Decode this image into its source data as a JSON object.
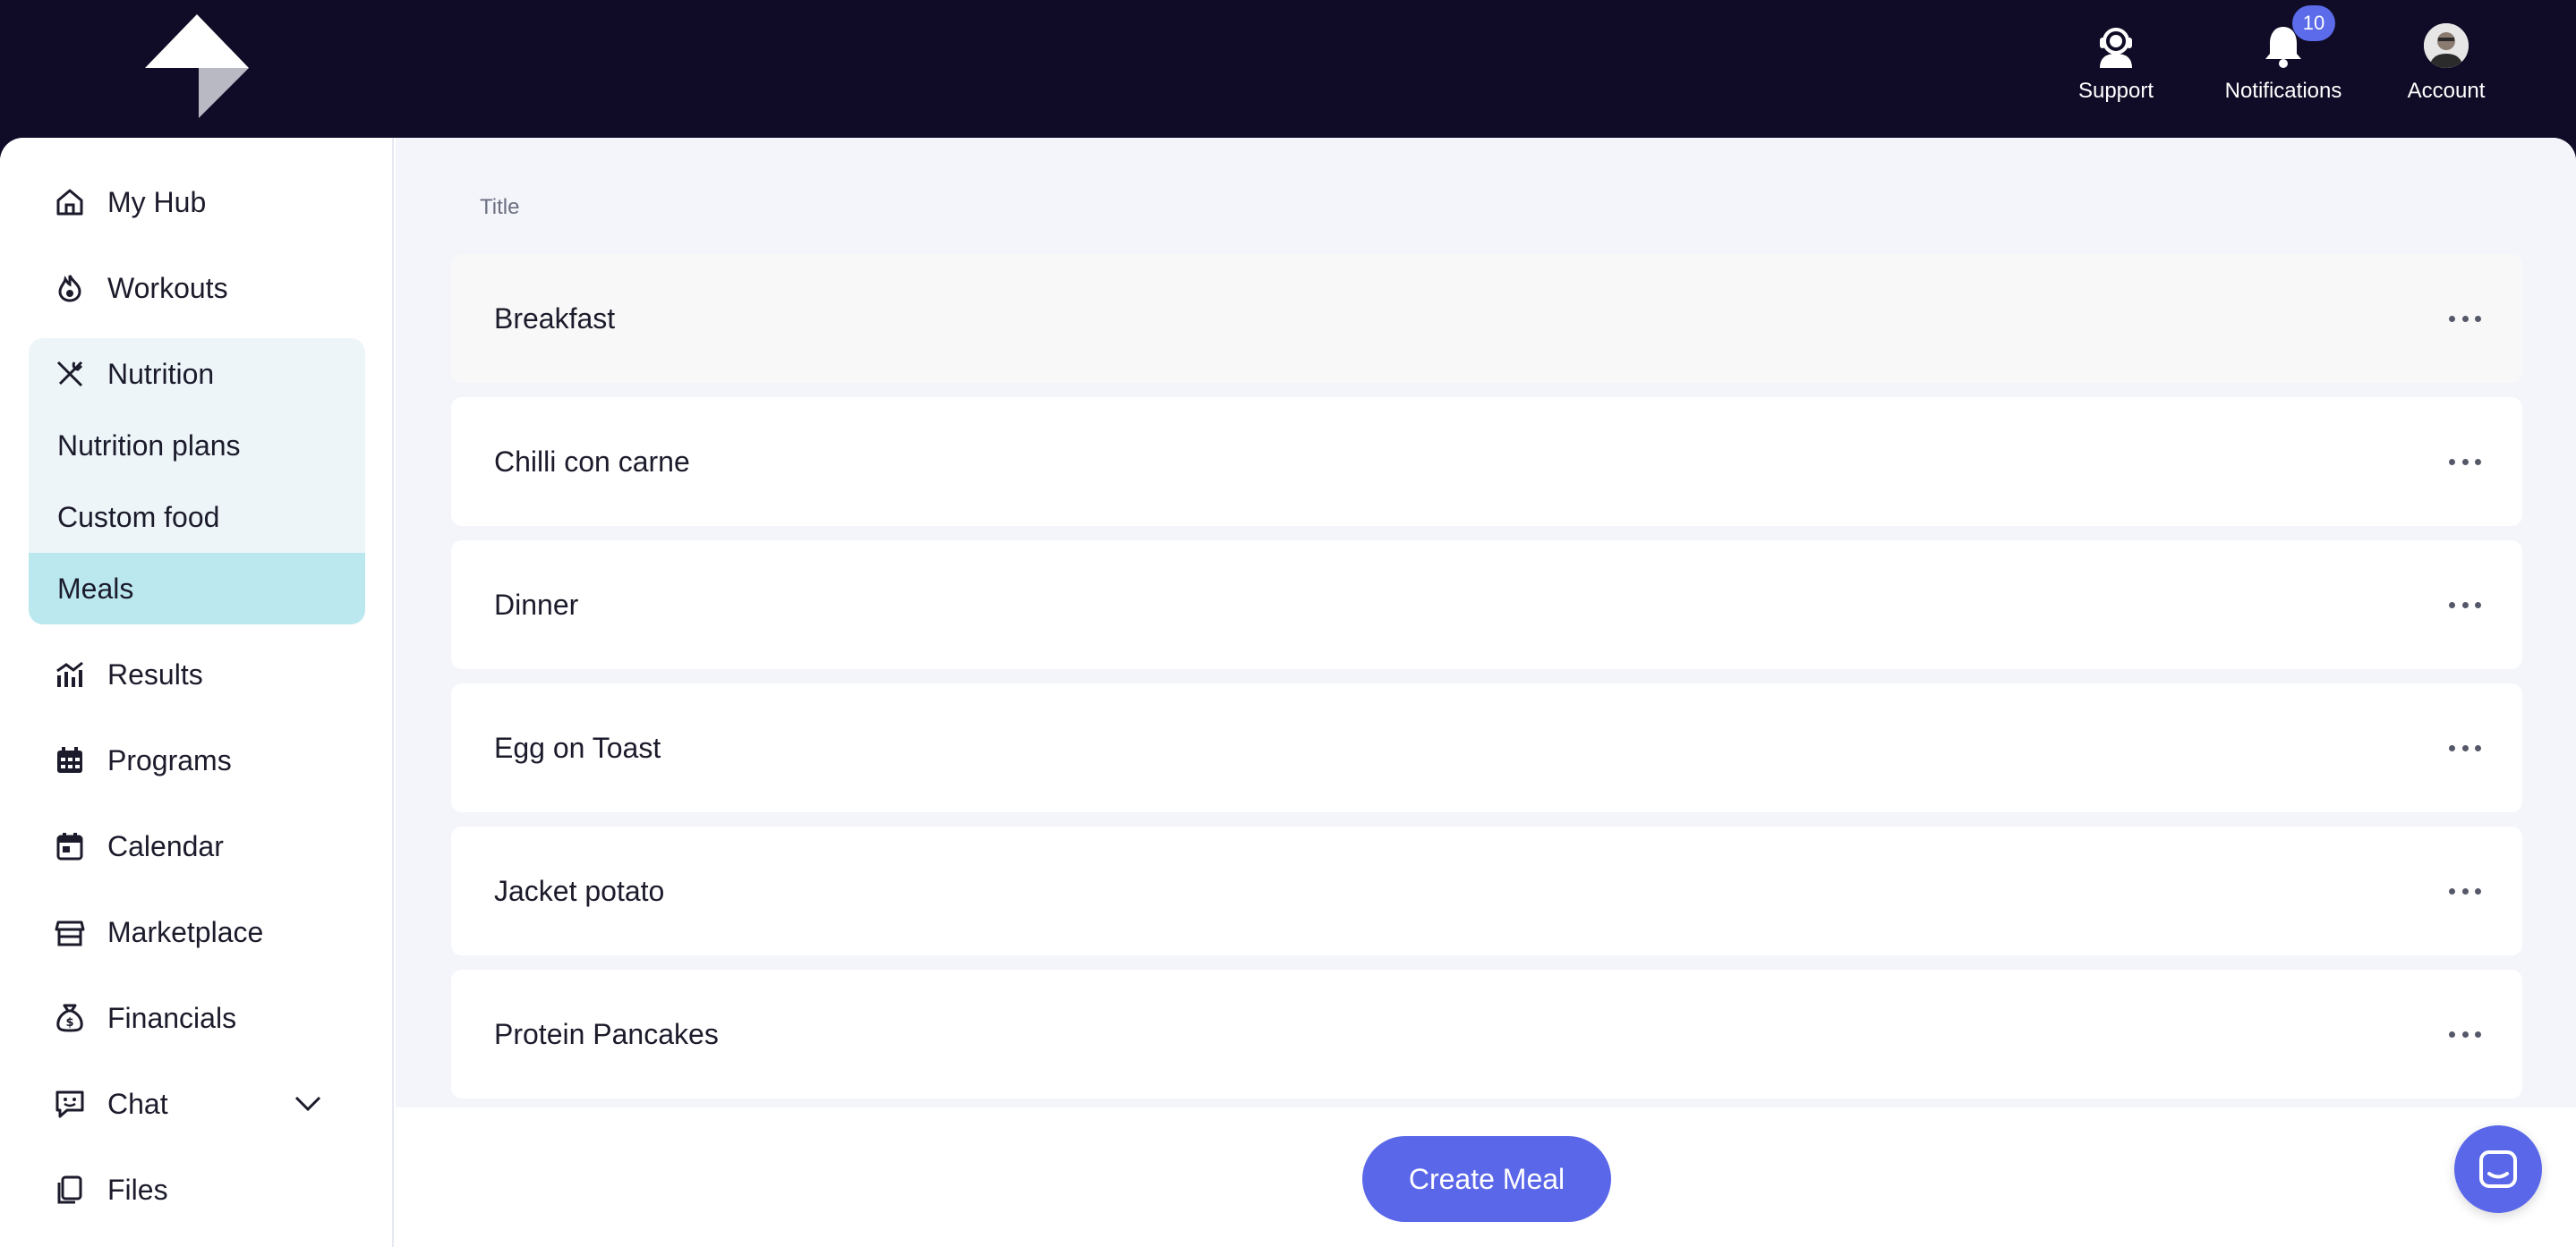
{
  "header": {
    "support_label": "Support",
    "notifications_label": "Notifications",
    "notifications_count": "10",
    "account_label": "Account"
  },
  "sidebar": {
    "items": [
      {
        "label": "My Hub",
        "icon": "home-icon"
      },
      {
        "label": "Workouts",
        "icon": "flame-icon"
      },
      {
        "label": "Nutrition",
        "icon": "utensils-icon"
      },
      {
        "label": "Results",
        "icon": "chart-icon"
      },
      {
        "label": "Programs",
        "icon": "calendar-grid-icon"
      },
      {
        "label": "Calendar",
        "icon": "calendar-icon"
      },
      {
        "label": "Marketplace",
        "icon": "store-icon"
      },
      {
        "label": "Financials",
        "icon": "money-bag-icon"
      },
      {
        "label": "Chat",
        "icon": "chat-icon"
      },
      {
        "label": "Files",
        "icon": "files-icon"
      }
    ],
    "nutrition_sub": [
      "Nutrition plans",
      "Custom food",
      "Meals"
    ],
    "active_sub": "Meals"
  },
  "main": {
    "column_title": "Title",
    "meals": [
      "Breakfast",
      "Chilli con carne",
      "Dinner",
      "Egg on Toast",
      "Jacket potato",
      "Protein Pancakes"
    ],
    "create_button": "Create Meal"
  },
  "colors": {
    "topbar": "#100c27",
    "accent": "#5a67e8",
    "active_nav": "#bbe8ef"
  }
}
